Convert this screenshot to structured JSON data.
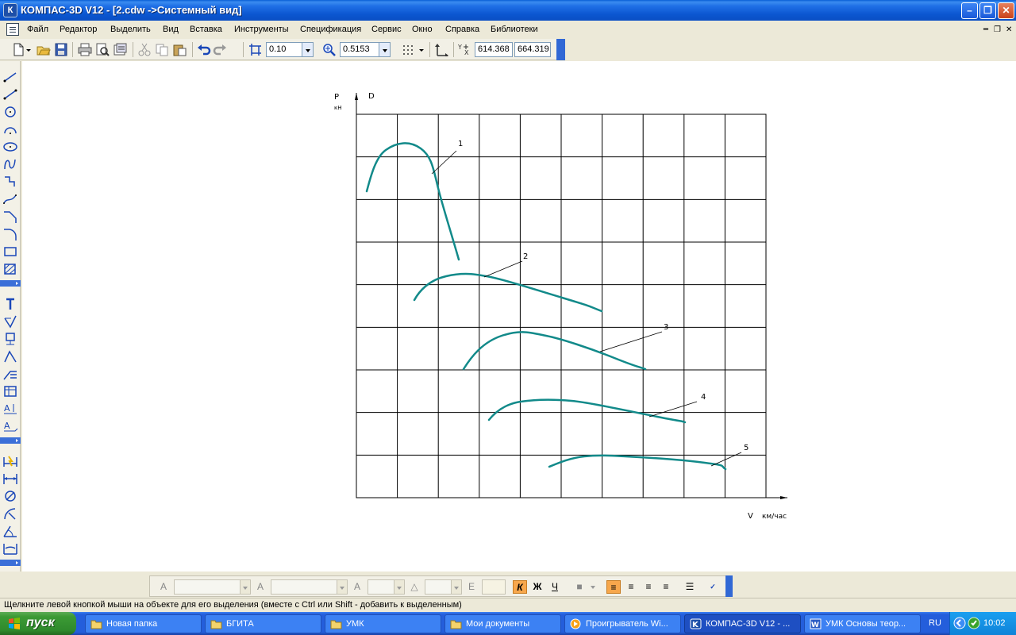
{
  "window": {
    "title": "КОМПАС-3D V12 - [2.cdw ->Системный вид]",
    "app_icon_letter": "К"
  },
  "menu": {
    "items": [
      "Файл",
      "Редактор",
      "Выделить",
      "Вид",
      "Вставка",
      "Инструменты",
      "Спецификация",
      "Сервис",
      "Окно",
      "Справка",
      "Библиотеки"
    ]
  },
  "toolbar": {
    "step_value": "0.10",
    "zoom_value": "0.5153",
    "coord_x": "614.368",
    "coord_y": "664.319"
  },
  "drawing": {
    "y_axis_label_p": "P",
    "y_axis_unit": "кН",
    "y_axis_label_d": "D",
    "x_axis_label": "V",
    "x_axis_unit": "км/час",
    "curve_labels": [
      "1",
      "2",
      "3",
      "4",
      "5"
    ],
    "grid_columns": 10,
    "grid_rows": 9,
    "curve_color": "#128a8a"
  },
  "text_toolbar": {
    "active_color": "#f7a74c",
    "bold_label": "Ж",
    "italic_label": "К",
    "underline_label": "Ч"
  },
  "status": {
    "text": "Щелкните левой кнопкой мыши на объекте для его выделения (вместе с Ctrl или Shift - добавить к выделенным)"
  },
  "taskbar": {
    "start_label": "пуск",
    "tasks": [
      {
        "label": "Новая папка",
        "icon": "folder-icon"
      },
      {
        "label": "БГИТА",
        "icon": "folder-icon"
      },
      {
        "label": "УМК",
        "icon": "folder-icon"
      },
      {
        "label": "Мои документы",
        "icon": "folder-icon"
      },
      {
        "label": "Проигрыватель Wi...",
        "icon": "media-player-icon"
      },
      {
        "label": "КОМПАС-3D V12 - ...",
        "icon": "kompas-icon"
      },
      {
        "label": "УМК Основы теор...",
        "icon": "word-icon"
      }
    ],
    "language": "RU",
    "clock": "10:02"
  }
}
